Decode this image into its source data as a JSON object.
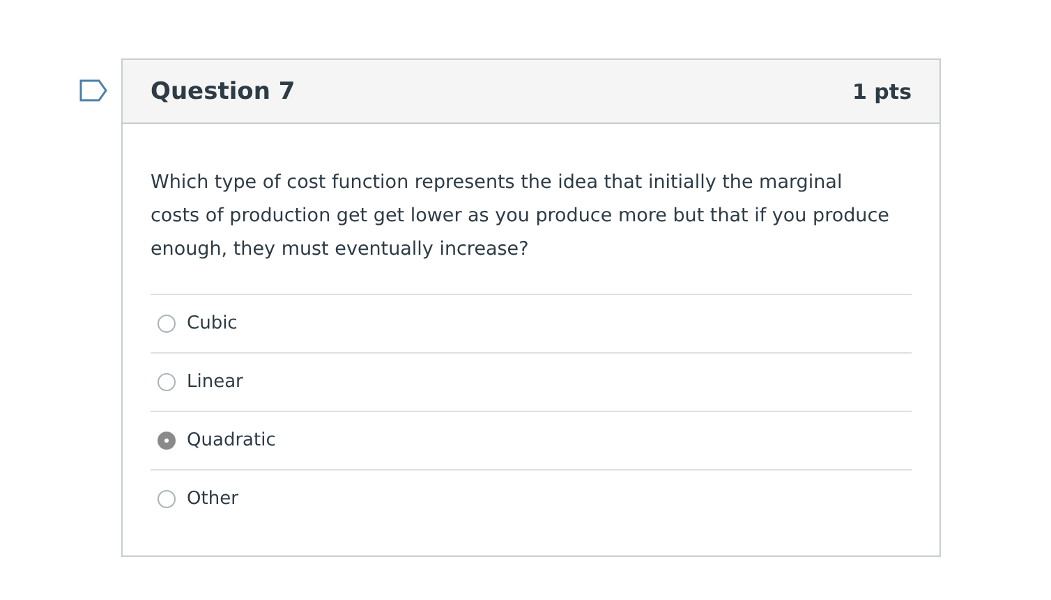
{
  "question": {
    "title": "Question 7",
    "points": "1 pts",
    "text": "Which type of cost function represents the idea that initially the marginal costs of production get get lower as you produce more but that if you produce enough, they must eventually increase?",
    "answers": [
      {
        "label": "Cubic",
        "selected": false
      },
      {
        "label": "Linear",
        "selected": false
      },
      {
        "label": "Quadratic",
        "selected": true
      },
      {
        "label": "Other",
        "selected": false
      }
    ]
  }
}
